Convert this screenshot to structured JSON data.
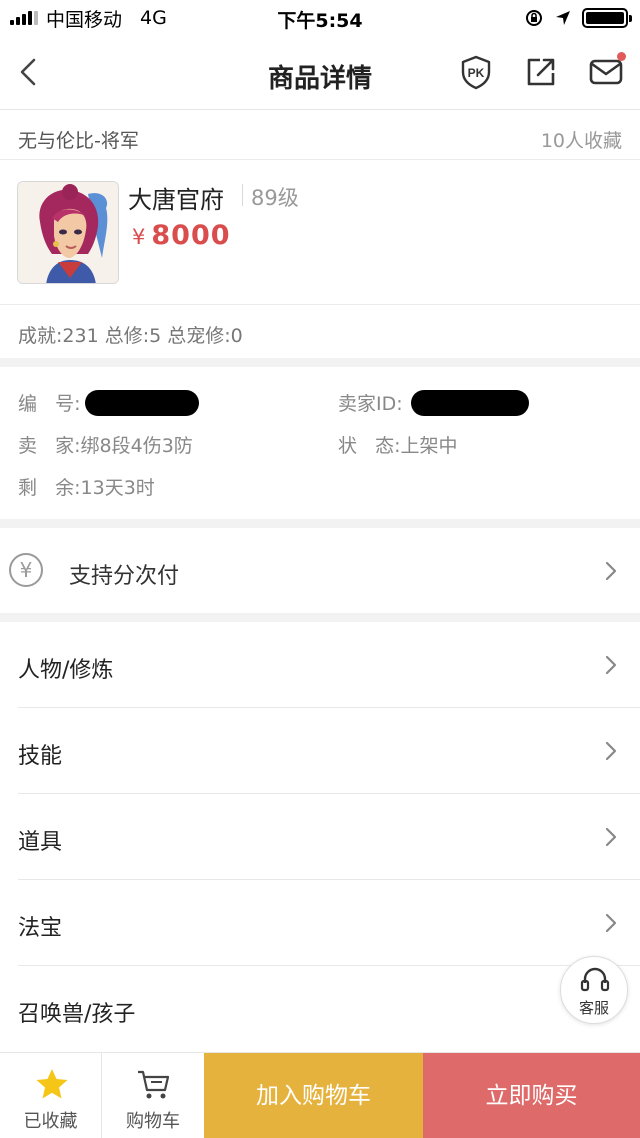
{
  "status_bar": {
    "carrier": "中国移动",
    "network": "4G",
    "time": "下午5:54"
  },
  "nav": {
    "title": "商品详情",
    "icons": [
      "back-arrow-icon",
      "pk-shield-icon",
      "share-icon",
      "mail-icon"
    ]
  },
  "product": {
    "name": "无与伦比-将军",
    "favorites": "10人收藏",
    "school": "大唐官府",
    "level": "89级",
    "currency": "¥",
    "price": "8000",
    "achievements": "成就:231 总修:5 总宠修:0"
  },
  "info": {
    "id_label": "编   号:",
    "seller_id_label": "卖家ID:",
    "seller_label": "卖   家:",
    "seller_value": "绑8段4伤3防",
    "status_label": "状   态:",
    "status_value": "上架中",
    "remain_label": "剩   余:",
    "remain_value": "13天3时"
  },
  "installment": {
    "icon_glyph": "¥",
    "label": "支持分次付"
  },
  "menu": [
    {
      "label": "人物/修炼"
    },
    {
      "label": "技能"
    },
    {
      "label": "道具"
    },
    {
      "label": "法宝"
    },
    {
      "label": "召唤兽/孩子"
    }
  ],
  "customer_service": {
    "label": "客服"
  },
  "bottom_bar": {
    "fav_label": "已收藏",
    "cart_label": "购物车",
    "add_cart_label": "加入购物车",
    "buy_label": "立即购买"
  },
  "colors": {
    "price": "#d94d4d",
    "add_cart_bg": "#e6b23e",
    "buy_bg": "#de6a6a",
    "star": "#f5c518"
  }
}
